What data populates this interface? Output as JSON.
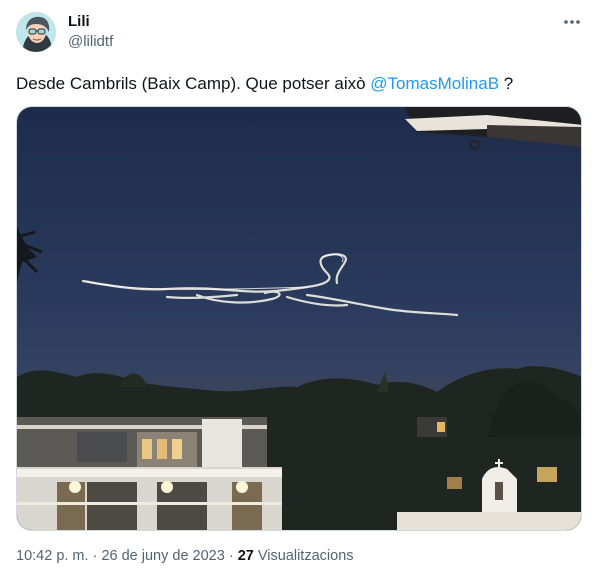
{
  "user": {
    "display_name": "Lili",
    "handle": "@lilidtf"
  },
  "tweet": {
    "text": "Desde Cambrils (Baix Camp). Que potser això ",
    "mention": "@TomasMolinaB",
    "text_after": " ?",
    "time": "10:42 p. m.",
    "date": "26 de juny de 2023",
    "views_count": "27",
    "views_label": "Visualitzacions"
  },
  "colors": {
    "link": "#1d9bf0",
    "muted": "#536471"
  },
  "icons": {
    "more": "more-horizontal-icon"
  }
}
